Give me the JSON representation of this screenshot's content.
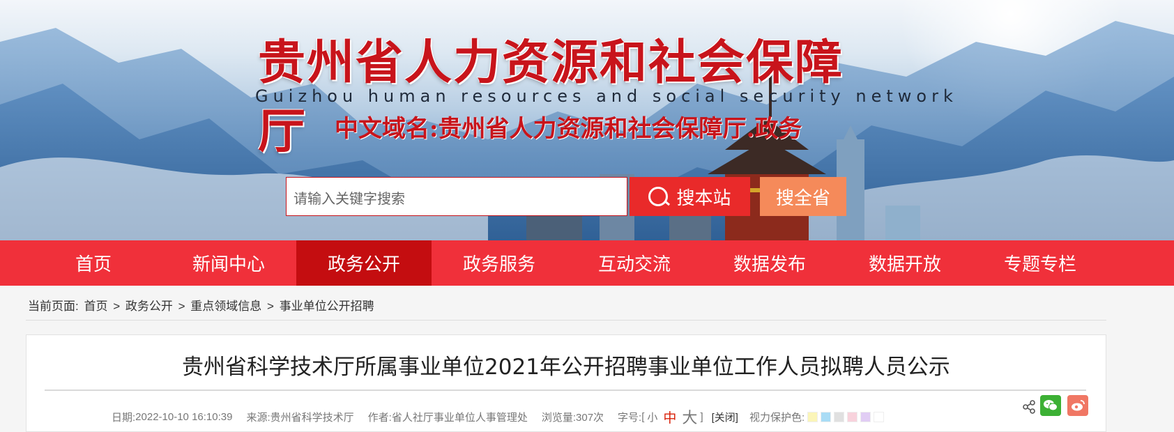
{
  "header": {
    "title": "贵州省人力资源和社会保障厅",
    "subtitle": "Guizhou human resources and social security network",
    "domain": "中文域名:贵州省人力资源和社会保障厅.政务"
  },
  "search": {
    "placeholder": "请输入关键字搜索",
    "site_button": "搜本站",
    "province_button": "搜全省"
  },
  "nav": {
    "items": [
      {
        "label": "首页"
      },
      {
        "label": "新闻中心"
      },
      {
        "label": "政务公开"
      },
      {
        "label": "政务服务"
      },
      {
        "label": "互动交流"
      },
      {
        "label": "数据发布"
      },
      {
        "label": "数据开放"
      },
      {
        "label": "专题专栏"
      }
    ],
    "active": "政务公开"
  },
  "breadcrumb": {
    "prefix": "当前页面:",
    "items": [
      "首页",
      "政务公开",
      "重点领域信息",
      "事业单位公开招聘"
    ],
    "sep": ">"
  },
  "article": {
    "title": "贵州省科学技术厅所属事业单位2021年公开招聘事业单位工作人员拟聘人员公示",
    "date_label": "日期:",
    "date": "2022-10-10 16:10:39",
    "source_label": "来源:",
    "source": "贵州省科学技术厅",
    "author_label": "作者:",
    "author": "省人社厅事业单位人事管理处",
    "views_label": "浏览量:",
    "views": "307次",
    "font_label": "字号:",
    "bracket_open": "[",
    "bracket_close": "]",
    "font_small": "小",
    "font_medium": "中",
    "font_large": "大",
    "close": "[关闭]",
    "eye_label": "视力保护色:"
  },
  "colors": {
    "accent": "#f0303a",
    "active_nav": "#c40d10",
    "title_red": "#c8141b",
    "swatches": [
      "#fbf5b8",
      "#a9dcf5",
      "#e0e0e0",
      "#f8d2dc",
      "#e1cdf4",
      "#ffffff"
    ]
  },
  "icons": {
    "share": "share-icon",
    "wechat": "wechat-icon",
    "weibo": "weibo-icon",
    "search": "search-icon"
  }
}
